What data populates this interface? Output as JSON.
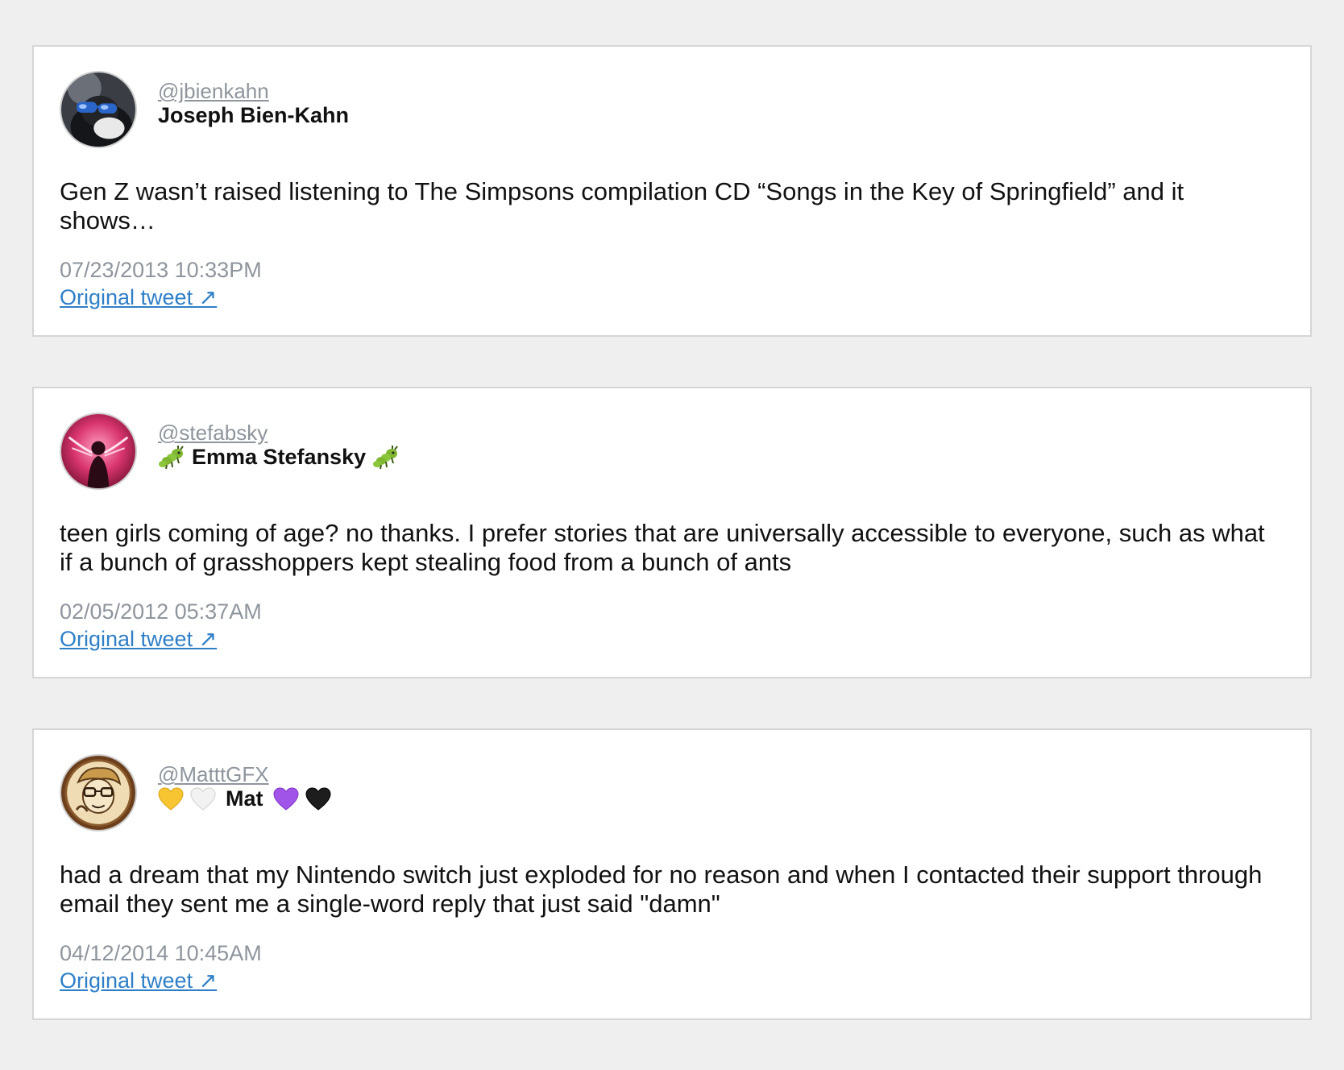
{
  "tweets": [
    {
      "handle": "@jbienkahn",
      "name_prefix": "",
      "name": "Joseph Bien-Kahn",
      "name_suffix": "",
      "text": "Gen Z wasn’t raised listening to The Simpsons compilation CD “Songs in the Key of Springfield” and it shows…",
      "timestamp": "07/23/2013 10:33PM",
      "link_label": "Original tweet ↗",
      "avatar_icon": "dog-with-sunglasses-avatar"
    },
    {
      "handle": "@stefabsky",
      "name_prefix_icon": "bug-emoji",
      "name": "Emma Stefansky",
      "name_suffix_icon": "bug-emoji",
      "text": "teen girls coming of age? no thanks. I prefer stories that are universally accessible to everyone, such as what if a bunch of grasshoppers kept stealing food from a bunch of ants",
      "timestamp": "02/05/2012 05:37AM",
      "link_label": "Original tweet ↗",
      "avatar_icon": "pink-silhouette-avatar"
    },
    {
      "handle": "@MatttGFX",
      "name_prefix_icons": [
        "yellow-heart-emoji",
        "white-heart-emoji"
      ],
      "name": "Mat",
      "name_suffix_icons": [
        "purple-heart-emoji",
        "black-heart-emoji"
      ],
      "text": "had a dream that my Nintendo switch just exploded for no reason and when I contacted their support through email they sent me a single-word reply that just said \"damn\"",
      "timestamp": "04/12/2014 10:45AM",
      "link_label": "Original tweet ↗",
      "avatar_icon": "cartoon-face-avatar"
    }
  ],
  "colors": {
    "background": "#efefef",
    "card": "#ffffff",
    "border": "#d6d6d6",
    "muted": "#8e959c",
    "link": "#2f7fc7",
    "text": "#111111"
  }
}
